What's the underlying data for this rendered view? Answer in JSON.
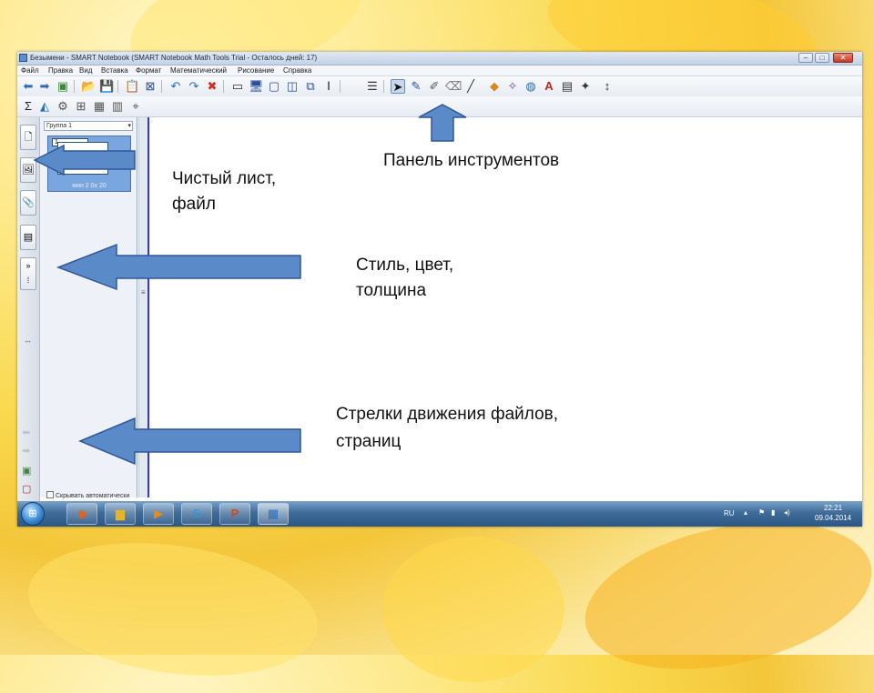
{
  "window": {
    "title": "Безымени - SMART Notebook (SMART Notebook Math Tools Trial - Осталось дней: 17)",
    "minimize": "–",
    "maximize": "□",
    "close": "✕"
  },
  "menubar": {
    "items": [
      "Файл",
      "Правка",
      "Вид",
      "Вставка",
      "Формат",
      "Математический",
      "Рисование",
      "Справка"
    ]
  },
  "toolbar": {
    "row1_icons": [
      "back-arrow-icon",
      "forward-arrow-icon",
      "new-page-icon",
      "open-folder-icon",
      "save-icon",
      "paste-icon",
      "delete-box-icon",
      "undo-icon",
      "redo-icon",
      "delete-x-icon",
      "screen-shade-icon",
      "display-icon",
      "monitor-icon",
      "document-camera-icon",
      "capture-icon",
      "text-tool-icon",
      "table-icon",
      "select-pointer-icon",
      "pen-icon",
      "creative-pen-icon",
      "eraser-icon",
      "line-icon",
      "shape-icon",
      "magic-pen-icon",
      "fill-icon",
      "text-a-icon",
      "properties-icon",
      "spell-icon",
      "move-toolbar-icon"
    ],
    "row2_icons": [
      "sigma-icon",
      "math-shape-icon",
      "compass-icon",
      "graph-icon",
      "table-math-icon",
      "chart-icon",
      "measure-icon"
    ]
  },
  "sorter": {
    "header": "Группа 1",
    "page_number": "1",
    "thumb_label": "мин 2 0x 20",
    "auto_hide": "Скрывать автоматически"
  },
  "taskbar": {
    "apps": [
      "start-orb-icon",
      "firefox-icon",
      "explorer-icon",
      "media-player-icon",
      "skype-icon",
      "powerpoint-icon",
      "smart-notebook-icon"
    ],
    "lang": "RU",
    "time": "22:21",
    "date": "09.04.2014"
  },
  "annotations": {
    "toolbar_label": "Панель инструментов",
    "blank_sheet_line1": "Чистый лист,",
    "blank_sheet_line2": "файл",
    "style_line1": "Стиль, цвет,",
    "style_line2": "толщина",
    "arrows_line1": "Стрелки движения файлов,",
    "arrows_line2": "страниц"
  },
  "colors": {
    "arrow_fill": "#5b8ac9",
    "arrow_stroke": "#30579a",
    "background": "#f9d94e"
  }
}
